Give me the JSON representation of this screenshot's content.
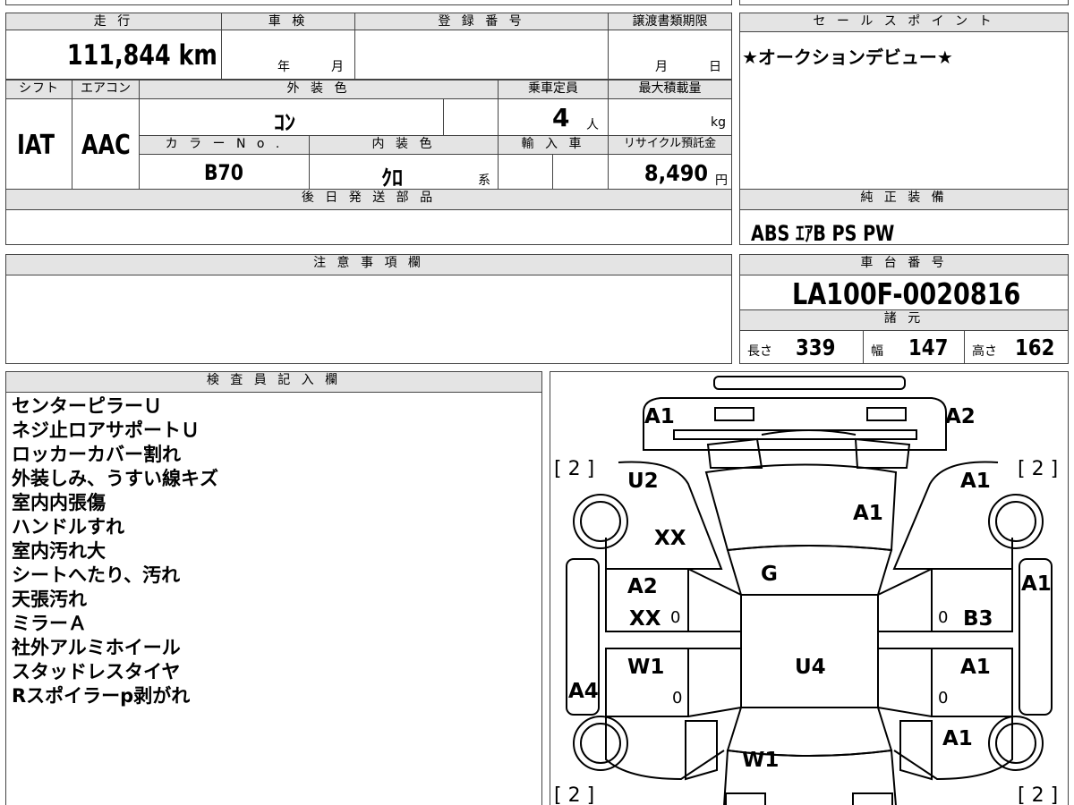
{
  "top_left": {
    "headers": {
      "mileage": "走 行",
      "inspection": "車 検",
      "registration": "登 録 番 号",
      "transfer_deadline": "譲渡書類期限",
      "shift": "シフト",
      "aircon": "エアコン",
      "exterior_color": "外 装 色",
      "capacity": "乗車定員",
      "max_load": "最大積載量",
      "color_no": "カ ラ ー N o .",
      "interior_color": "内 装 色",
      "import": "輸 入 車",
      "recycle_fee": "リサイクル預託金",
      "later_parts": "後 日 発 送 部 品"
    },
    "mileage_value": "111,844 km",
    "inspection_year_unit": "年",
    "inspection_month_unit": "月",
    "deadline_month_unit": "月",
    "deadline_day_unit": "日",
    "shift_value": "IAT",
    "aircon_value": "AAC",
    "exterior_color_value": "ｺﾝ",
    "capacity_value": "4",
    "capacity_unit": "人",
    "max_load_unit": "kg",
    "color_no_value": "B70",
    "interior_color_value": "ｸﾛ",
    "interior_color_suffix": "系",
    "recycle_value": "8,490",
    "recycle_unit": "円"
  },
  "sales_point": {
    "header": "セ ー ル ス ポ イ ン ト",
    "text": "★オークションデビュー★"
  },
  "equipment": {
    "header": "純 正 装 備",
    "text": "ABS ｴｱB PS PW"
  },
  "notes": {
    "header": "注 意 事 項 欄"
  },
  "chassis": {
    "header": "車 台 番 号",
    "number": "LA100F-0020816",
    "specs_header": "諸 元",
    "length_label": "長さ",
    "length_value": "339",
    "width_label": "幅",
    "width_value": "147",
    "height_label": "高さ",
    "height_value": "162"
  },
  "inspector": {
    "header": "検 査 員 記 入 欄",
    "lines": [
      "センターピラーＵ",
      "ネジ止ロアサポートＵ",
      "ロッカーカバー割れ",
      "外装しみ、うすい線キズ",
      "室内内張傷",
      "ハンドルすれ",
      "室内汚れ大",
      "シートへたり、汚れ",
      "天張汚れ",
      "ミラーＡ",
      "社外アルミホイール",
      "スタッドレスタイヤ",
      "Rスポイラーp剥がれ"
    ]
  },
  "diagram": {
    "marks": {
      "front_left": "A1",
      "front_right": "A2",
      "fender_left": "U2",
      "fender_right": "A1",
      "hood": "A1",
      "fender_left_2": "XX",
      "windshield": "G",
      "front_door_left_1": "A2",
      "front_door_left_2": "XX",
      "front_door_right": "B3",
      "right_pillar": "A1",
      "roof": "U4",
      "rear_door_left": "W1",
      "rear_door_right": "A1",
      "left_rocker": "A4",
      "rear_quarter_right": "A1",
      "rear_glass": "W1"
    },
    "tire_tread": {
      "front_left": "[ 2 ]",
      "front_right": "[ 2 ]",
      "rear_left": "[ 2 ]",
      "rear_right": "[ 2 ]"
    },
    "zeros": [
      "0",
      "0",
      "0",
      "0"
    ]
  }
}
